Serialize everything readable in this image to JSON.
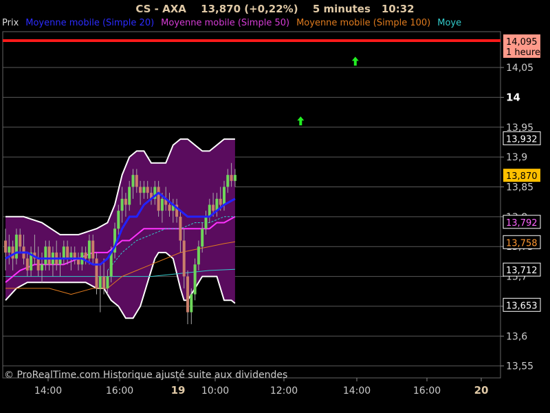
{
  "header": {
    "symbol": "CS - AXA",
    "price_change": "13,870 (+0,22%)",
    "interval": "5 minutes",
    "time": "10:32"
  },
  "legend": [
    {
      "label": "Prix",
      "color": "#dddddd"
    },
    {
      "label": "Moyenne mobile (Simple 20)",
      "color": "#2b2bff"
    },
    {
      "label": "Moyenne mobile (Simple 50)",
      "color": "#d63cd6"
    },
    {
      "label": "Moyenne mobile (Simple 100)",
      "color": "#e07b1e"
    },
    {
      "label": "Moye",
      "color": "#33cccc"
    }
  ],
  "watermark": "© ProRealTime.com Historique ajusté suite aux dividendes",
  "chart_data": {
    "type": "candlestick",
    "y_axis": {
      "min": 13.53,
      "max": 14.11,
      "ticks": [
        {
          "value": 14.05,
          "label": "14,05",
          "bold": false
        },
        {
          "value": 14.0,
          "label": "14",
          "bold": true
        },
        {
          "value": 13.95,
          "label": "13,95",
          "bold": false
        },
        {
          "value": 13.9,
          "label": "13,9",
          "bold": false
        },
        {
          "value": 13.85,
          "label": "13,85",
          "bold": false
        },
        {
          "value": 13.8,
          "label": "13,8",
          "bold": false
        },
        {
          "value": 13.75,
          "label": "13,75",
          "bold": false
        },
        {
          "value": 13.7,
          "label": "13,7",
          "bold": false
        },
        {
          "value": 13.65,
          "label": "13,65",
          "bold": false
        },
        {
          "value": 13.6,
          "label": "13,6",
          "bold": false
        },
        {
          "value": 13.55,
          "label": "13,55",
          "bold": false
        }
      ]
    },
    "x_axis": {
      "ticks": [
        {
          "label": "14:00",
          "bold": false
        },
        {
          "label": "16:00",
          "bold": false
        },
        {
          "label": "19",
          "bold": true
        },
        {
          "label": "10:00",
          "bold": false
        },
        {
          "label": "12:00",
          "bold": false
        },
        {
          "label": "14:00",
          "bold": false
        },
        {
          "label": "16:00",
          "bold": false
        },
        {
          "label": "20",
          "bold": true
        }
      ]
    },
    "price_labels": [
      {
        "value": 14.095,
        "label": "14,095",
        "sub": "1 heure",
        "bg": "#ff9a8a",
        "fg": "#000000"
      },
      {
        "value": 13.932,
        "label": "13,932",
        "bg": "#000000",
        "fg": "#ffffff",
        "border": "#ffffff"
      },
      {
        "value": 13.87,
        "label": "13,870",
        "bg": "#ffc000",
        "fg": "#000000"
      },
      {
        "value": 13.792,
        "label": "13,792",
        "bg": "#000000",
        "fg": "#ff66ff",
        "border": "#ffffff"
      },
      {
        "value": 13.758,
        "label": "13,758",
        "bg": "#000000",
        "fg": "#ff9933",
        "border": "#ffffff"
      },
      {
        "value": 13.712,
        "label": "13,712",
        "bg": "#000000",
        "fg": "#ffffff",
        "border": "#ffffff"
      },
      {
        "value": 13.653,
        "label": "13,653",
        "bg": "#000000",
        "fg": "#ffffff",
        "border": "#ffffff"
      }
    ],
    "resistance_line": 14.095,
    "signal_arrows": [
      {
        "slot": 96,
        "value": 14.06
      },
      {
        "slot": 81,
        "value": 13.96
      }
    ],
    "candles": [
      {
        "o": 13.76,
        "h": 13.78,
        "l": 13.71,
        "c": 13.74
      },
      {
        "o": 13.74,
        "h": 13.77,
        "l": 13.72,
        "c": 13.75
      },
      {
        "o": 13.75,
        "h": 13.76,
        "l": 13.71,
        "c": 13.73
      },
      {
        "o": 13.73,
        "h": 13.78,
        "l": 13.72,
        "c": 13.77
      },
      {
        "o": 13.77,
        "h": 13.78,
        "l": 13.74,
        "c": 13.75
      },
      {
        "o": 13.75,
        "h": 13.77,
        "l": 13.72,
        "c": 13.73
      },
      {
        "o": 13.73,
        "h": 13.74,
        "l": 13.7,
        "c": 13.71
      },
      {
        "o": 13.71,
        "h": 13.75,
        "l": 13.7,
        "c": 13.74
      },
      {
        "o": 13.74,
        "h": 13.77,
        "l": 13.72,
        "c": 13.73
      },
      {
        "o": 13.73,
        "h": 13.75,
        "l": 13.7,
        "c": 13.71
      },
      {
        "o": 13.71,
        "h": 13.74,
        "l": 13.69,
        "c": 13.72
      },
      {
        "o": 13.72,
        "h": 13.76,
        "l": 13.71,
        "c": 13.75
      },
      {
        "o": 13.75,
        "h": 13.76,
        "l": 13.71,
        "c": 13.72
      },
      {
        "o": 13.72,
        "h": 13.75,
        "l": 13.7,
        "c": 13.74
      },
      {
        "o": 13.74,
        "h": 13.76,
        "l": 13.71,
        "c": 13.72
      },
      {
        "o": 13.72,
        "h": 13.74,
        "l": 13.7,
        "c": 13.73
      },
      {
        "o": 13.73,
        "h": 13.76,
        "l": 13.72,
        "c": 13.75
      },
      {
        "o": 13.75,
        "h": 13.76,
        "l": 13.72,
        "c": 13.73
      },
      {
        "o": 13.73,
        "h": 13.75,
        "l": 13.71,
        "c": 13.74
      },
      {
        "o": 13.74,
        "h": 13.75,
        "l": 13.72,
        "c": 13.73
      },
      {
        "o": 13.73,
        "h": 13.74,
        "l": 13.71,
        "c": 13.72
      },
      {
        "o": 13.72,
        "h": 13.75,
        "l": 13.71,
        "c": 13.74
      },
      {
        "o": 13.74,
        "h": 13.75,
        "l": 13.72,
        "c": 13.73
      },
      {
        "o": 13.73,
        "h": 13.77,
        "l": 13.72,
        "c": 13.76
      },
      {
        "o": 13.76,
        "h": 13.77,
        "l": 13.72,
        "c": 13.73
      },
      {
        "o": 13.73,
        "h": 13.74,
        "l": 13.67,
        "c": 13.68
      },
      {
        "o": 13.68,
        "h": 13.72,
        "l": 13.64,
        "c": 13.7
      },
      {
        "o": 13.7,
        "h": 13.73,
        "l": 13.67,
        "c": 13.68
      },
      {
        "o": 13.68,
        "h": 13.71,
        "l": 13.67,
        "c": 13.7
      },
      {
        "o": 13.7,
        "h": 13.75,
        "l": 13.69,
        "c": 13.74
      },
      {
        "o": 13.74,
        "h": 13.79,
        "l": 13.73,
        "c": 13.78
      },
      {
        "o": 13.78,
        "h": 13.82,
        "l": 13.77,
        "c": 13.81
      },
      {
        "o": 13.81,
        "h": 13.85,
        "l": 13.79,
        "c": 13.83
      },
      {
        "o": 13.83,
        "h": 13.84,
        "l": 13.8,
        "c": 13.82
      },
      {
        "o": 13.82,
        "h": 13.86,
        "l": 13.81,
        "c": 13.85
      },
      {
        "o": 13.85,
        "h": 13.88,
        "l": 13.83,
        "c": 13.87
      },
      {
        "o": 13.87,
        "h": 13.88,
        "l": 13.84,
        "c": 13.85
      },
      {
        "o": 13.85,
        "h": 13.86,
        "l": 13.82,
        "c": 13.84
      },
      {
        "o": 13.84,
        "h": 13.86,
        "l": 13.83,
        "c": 13.85
      },
      {
        "o": 13.85,
        "h": 13.86,
        "l": 13.83,
        "c": 13.84
      },
      {
        "o": 13.84,
        "h": 13.85,
        "l": 13.82,
        "c": 13.83
      },
      {
        "o": 13.83,
        "h": 13.86,
        "l": 13.82,
        "c": 13.85
      },
      {
        "o": 13.85,
        "h": 13.86,
        "l": 13.8,
        "c": 13.81
      },
      {
        "o": 13.81,
        "h": 13.84,
        "l": 13.79,
        "c": 13.83
      },
      {
        "o": 13.83,
        "h": 13.85,
        "l": 13.81,
        "c": 13.82
      },
      {
        "o": 13.82,
        "h": 13.84,
        "l": 13.8,
        "c": 13.81
      },
      {
        "o": 13.81,
        "h": 13.83,
        "l": 13.79,
        "c": 13.82
      },
      {
        "o": 13.82,
        "h": 13.83,
        "l": 13.79,
        "c": 13.8
      },
      {
        "o": 13.8,
        "h": 13.81,
        "l": 13.74,
        "c": 13.76
      },
      {
        "o": 13.76,
        "h": 13.78,
        "l": 13.68,
        "c": 13.7
      },
      {
        "o": 13.7,
        "h": 13.71,
        "l": 13.62,
        "c": 13.64
      },
      {
        "o": 13.64,
        "h": 13.68,
        "l": 13.62,
        "c": 13.67
      },
      {
        "o": 13.67,
        "h": 13.73,
        "l": 13.66,
        "c": 13.72
      },
      {
        "o": 13.72,
        "h": 13.76,
        "l": 13.71,
        "c": 13.75
      },
      {
        "o": 13.75,
        "h": 13.79,
        "l": 13.74,
        "c": 13.78
      },
      {
        "o": 13.78,
        "h": 13.81,
        "l": 13.77,
        "c": 13.8
      },
      {
        "o": 13.8,
        "h": 13.83,
        "l": 13.79,
        "c": 13.82
      },
      {
        "o": 13.82,
        "h": 13.84,
        "l": 13.8,
        "c": 13.81
      },
      {
        "o": 13.81,
        "h": 13.84,
        "l": 13.8,
        "c": 13.83
      },
      {
        "o": 13.83,
        "h": 13.85,
        "l": 13.81,
        "c": 13.82
      },
      {
        "o": 13.82,
        "h": 13.86,
        "l": 13.81,
        "c": 13.85
      },
      {
        "o": 13.85,
        "h": 13.88,
        "l": 13.84,
        "c": 13.87
      },
      {
        "o": 13.87,
        "h": 13.89,
        "l": 13.85,
        "c": 13.86
      },
      {
        "o": 13.86,
        "h": 13.88,
        "l": 13.85,
        "c": 13.87
      }
    ],
    "bollinger_upper": [
      [
        0,
        13.8
      ],
      [
        5,
        13.8
      ],
      [
        10,
        13.79
      ],
      [
        15,
        13.77
      ],
      [
        20,
        13.77
      ],
      [
        25,
        13.78
      ],
      [
        28,
        13.79
      ],
      [
        30,
        13.82
      ],
      [
        32,
        13.87
      ],
      [
        34,
        13.9
      ],
      [
        36,
        13.91
      ],
      [
        38,
        13.91
      ],
      [
        40,
        13.89
      ],
      [
        42,
        13.89
      ],
      [
        44,
        13.89
      ],
      [
        46,
        13.92
      ],
      [
        48,
        13.93
      ],
      [
        50,
        13.93
      ],
      [
        52,
        13.92
      ],
      [
        54,
        13.91
      ],
      [
        56,
        13.91
      ],
      [
        58,
        13.92
      ],
      [
        60,
        13.93
      ],
      [
        63,
        13.93
      ]
    ],
    "bollinger_lower": [
      [
        0,
        13.66
      ],
      [
        3,
        13.68
      ],
      [
        6,
        13.69
      ],
      [
        10,
        13.69
      ],
      [
        14,
        13.69
      ],
      [
        18,
        13.69
      ],
      [
        22,
        13.69
      ],
      [
        25,
        13.68
      ],
      [
        27,
        13.68
      ],
      [
        29,
        13.66
      ],
      [
        31,
        13.65
      ],
      [
        33,
        13.63
      ],
      [
        35,
        13.63
      ],
      [
        37,
        13.65
      ],
      [
        39,
        13.69
      ],
      [
        41,
        13.73
      ],
      [
        42,
        13.74
      ],
      [
        44,
        13.74
      ],
      [
        46,
        13.73
      ],
      [
        48,
        13.68
      ],
      [
        49,
        13.66
      ],
      [
        50,
        13.66
      ],
      [
        52,
        13.68
      ],
      [
        54,
        13.7
      ],
      [
        56,
        13.7
      ],
      [
        58,
        13.7
      ],
      [
        60,
        13.66
      ],
      [
        62,
        13.66
      ],
      [
        63,
        13.655
      ]
    ],
    "sma20": [
      [
        0,
        13.73
      ],
      [
        3,
        13.74
      ],
      [
        6,
        13.74
      ],
      [
        9,
        13.73
      ],
      [
        12,
        13.73
      ],
      [
        15,
        13.73
      ],
      [
        18,
        13.73
      ],
      [
        21,
        13.73
      ],
      [
        24,
        13.72
      ],
      [
        26,
        13.72
      ],
      [
        28,
        13.73
      ],
      [
        30,
        13.75
      ],
      [
        32,
        13.78
      ],
      [
        34,
        13.8
      ],
      [
        36,
        13.8
      ],
      [
        38,
        13.82
      ],
      [
        40,
        13.83
      ],
      [
        42,
        13.84
      ],
      [
        44,
        13.83
      ],
      [
        46,
        13.82
      ],
      [
        48,
        13.81
      ],
      [
        50,
        13.8
      ],
      [
        52,
        13.8
      ],
      [
        54,
        13.8
      ],
      [
        56,
        13.8
      ],
      [
        58,
        13.81
      ],
      [
        60,
        13.82
      ],
      [
        63,
        13.83
      ]
    ],
    "sma50": [
      [
        0,
        13.69
      ],
      [
        4,
        13.71
      ],
      [
        8,
        13.72
      ],
      [
        12,
        13.72
      ],
      [
        16,
        13.72
      ],
      [
        20,
        13.73
      ],
      [
        24,
        13.74
      ],
      [
        28,
        13.74
      ],
      [
        30,
        13.75
      ],
      [
        32,
        13.76
      ],
      [
        34,
        13.76
      ],
      [
        36,
        13.77
      ],
      [
        38,
        13.78
      ],
      [
        40,
        13.78
      ],
      [
        42,
        13.78
      ],
      [
        44,
        13.78
      ],
      [
        46,
        13.78
      ],
      [
        48,
        13.78
      ],
      [
        50,
        13.78
      ],
      [
        52,
        13.78
      ],
      [
        54,
        13.78
      ],
      [
        56,
        13.78
      ],
      [
        58,
        13.79
      ],
      [
        60,
        13.79
      ],
      [
        63,
        13.8
      ]
    ],
    "sma100": [
      [
        0,
        13.68
      ],
      [
        6,
        13.68
      ],
      [
        12,
        13.68
      ],
      [
        18,
        13.67
      ],
      [
        24,
        13.68
      ],
      [
        28,
        13.68
      ],
      [
        32,
        13.7
      ],
      [
        36,
        13.71
      ],
      [
        40,
        13.72
      ],
      [
        44,
        13.73
      ],
      [
        48,
        13.74
      ],
      [
        52,
        13.745
      ],
      [
        56,
        13.75
      ],
      [
        60,
        13.755
      ],
      [
        63,
        13.758
      ]
    ],
    "sma_extra": [
      [
        0,
        13.7
      ],
      [
        8,
        13.7
      ],
      [
        16,
        13.7
      ],
      [
        24,
        13.7
      ],
      [
        32,
        13.7
      ],
      [
        40,
        13.7
      ],
      [
        48,
        13.705
      ],
      [
        56,
        13.71
      ],
      [
        63,
        13.712
      ]
    ],
    "sma20_dashed": [
      [
        28,
        13.71
      ],
      [
        32,
        13.74
      ],
      [
        36,
        13.76
      ],
      [
        40,
        13.77
      ],
      [
        44,
        13.78
      ],
      [
        48,
        13.78
      ],
      [
        52,
        13.79
      ],
      [
        56,
        13.79
      ],
      [
        60,
        13.8
      ],
      [
        63,
        13.8
      ]
    ]
  }
}
